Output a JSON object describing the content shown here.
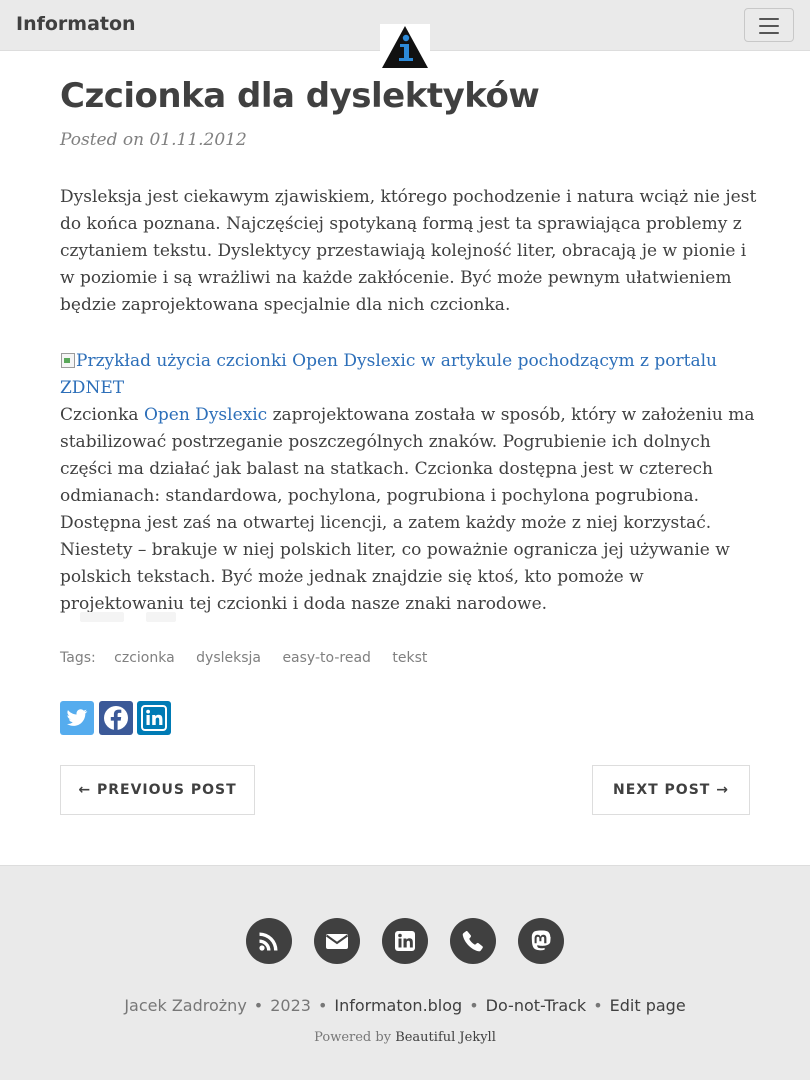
{
  "navbar": {
    "brand": "Informaton",
    "menu_icon": "hamburger-icon",
    "logo_icon": "info-triangle-logo"
  },
  "post": {
    "title": "Czcionka dla dyslektyków",
    "meta": "Posted on 01.11.2012",
    "para1": "Dysleksja jest ciekawym zjawiskiem, którego pochodzenie i natura wciąż nie jest do końca poznana. Najczęściej spotykaną formą jest ta sprawiająca problemy z czytaniem tekstu. Dyslektycy przestawiają kolejność liter, obracają je w pionie i w poziomie i są wrażliwi na każde zakłócenie. Być może pewnym ułatwieniem będzie zaprojektowana specjalnie dla nich czcionka.",
    "image_alt": "Przykład użycia czcionki Open Dyslexic w artykule pochodzącym z portalu ZDNET",
    "para2_before": "Czcionka ",
    "para2_link": "Open Dyslexic",
    "para2_after": " zaprojektowana została w sposób, który w założeniu ma stabilizować postrzeganie poszczególnych znaków. Pogrubienie ich dolnych części ma działać jak balast na statkach. Czcionka dostępna jest w czterech odmianach: standardowa, pochylona, pogrubiona i pochylona pogrubiona. Dostępna jest zaś na otwartej licencji, a zatem każdy może z niej korzystać. Niestety – brakuje w niej polskich liter, co poważnie ogranicza jej używanie w polskich tekstach. Być może jednak znajdzie się ktoś, kto pomoże w projektowaniu tej czcionki i doda nasze znaki narodowe."
  },
  "tags": {
    "label": "Tags:",
    "items": [
      "czcionka",
      "dysleksja",
      "easy-to-read",
      "tekst"
    ]
  },
  "share": {
    "icons": [
      "twitter-icon",
      "facebook-icon",
      "linkedin-icon"
    ],
    "colors": {
      "twitter": "#55acee",
      "facebook": "#3b5998",
      "linkedin": "#007bb5"
    }
  },
  "pager": {
    "previous": "← PREVIOUS POST",
    "next": "NEXT POST →"
  },
  "footer": {
    "icons": [
      "rss-icon",
      "envelope-icon",
      "linkedin-icon",
      "phone-icon",
      "mastodon-icon"
    ],
    "author": "Jacek Zadrożny",
    "year": "2023",
    "site": "Informaton.blog",
    "dnt": "Do-not-Track",
    "edit": "Edit page",
    "powered_by": "Powered by",
    "theme": "Beautiful Jekyll"
  },
  "colors": {
    "navbar_bg": "#eaeaea",
    "text": "#404040",
    "link": "#2d6fb9",
    "footer_bg": "#eaeaea"
  }
}
